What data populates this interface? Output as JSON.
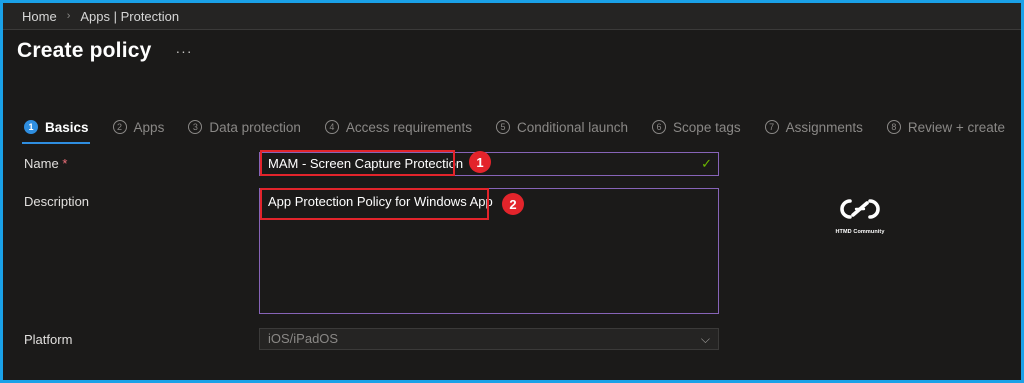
{
  "breadcrumb": {
    "home": "Home",
    "section": "Apps | Protection",
    "separator": "›"
  },
  "header": {
    "title": "Create policy",
    "more": "···"
  },
  "wizard": {
    "steps": [
      {
        "number": "1",
        "label": "Basics",
        "active": true
      },
      {
        "number": "2",
        "label": "Apps"
      },
      {
        "number": "3",
        "label": "Data protection"
      },
      {
        "number": "4",
        "label": "Access requirements"
      },
      {
        "number": "5",
        "label": "Conditional launch"
      },
      {
        "number": "6",
        "label": "Scope tags"
      },
      {
        "number": "7",
        "label": "Assignments"
      },
      {
        "number": "8",
        "label": "Review + create"
      }
    ]
  },
  "form": {
    "name": {
      "label": "Name",
      "required_mark": "*",
      "value": "MAM - Screen Capture Protection",
      "valid_icon": "✓"
    },
    "description": {
      "label": "Description",
      "value": "App Protection Policy for Windows App"
    },
    "platform": {
      "label": "Platform",
      "value": "iOS/iPadOS",
      "chevron": "⌵"
    }
  },
  "annotations": {
    "badge1": "1",
    "badge2": "2"
  },
  "watermark": {
    "caption": "HTMD Community"
  },
  "colors": {
    "accent": "#2f8ee0",
    "highlight": "#e3242b",
    "field_border": "#8764b8",
    "frame": "#1aa1e8",
    "valid": "#6bb700"
  }
}
